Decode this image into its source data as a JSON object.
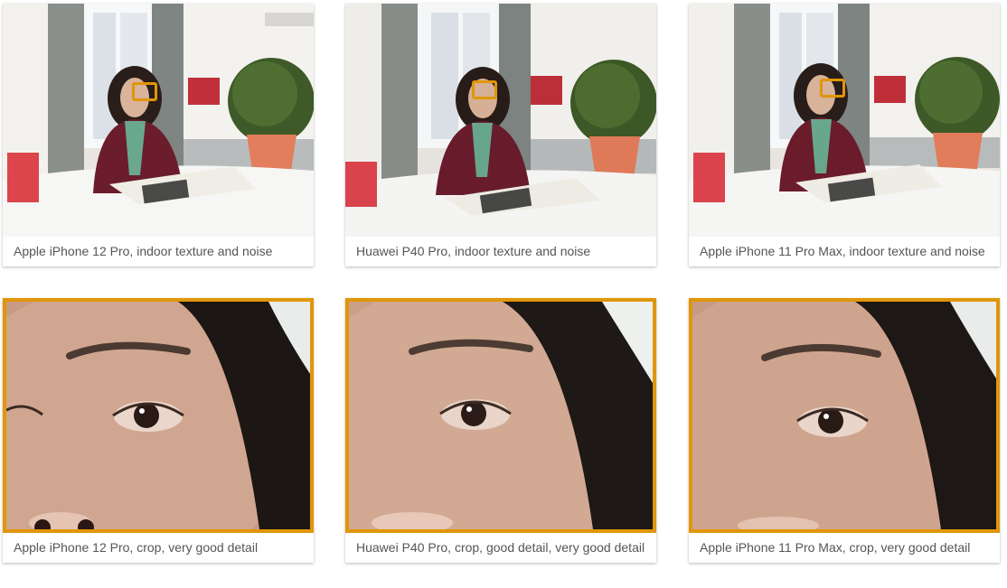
{
  "colors": {
    "highlight": "#e0960a",
    "caption": "#555555",
    "shadow": "rgba(0,0,0,0.28)"
  },
  "rows": [
    {
      "cards": [
        {
          "caption": "Apple iPhone 12 Pro, indoor texture and noise"
        },
        {
          "caption": "Huawei P40 Pro, indoor texture and noise"
        },
        {
          "caption": "Apple iPhone 11 Pro Max, indoor texture and noise"
        }
      ]
    },
    {
      "cards": [
        {
          "caption": "Apple iPhone 12 Pro, crop, very good detail"
        },
        {
          "caption": "Huawei P40 Pro, crop, good detail, very good detail"
        },
        {
          "caption": "Apple iPhone 11 Pro Max, crop, very good detail"
        }
      ]
    }
  ]
}
